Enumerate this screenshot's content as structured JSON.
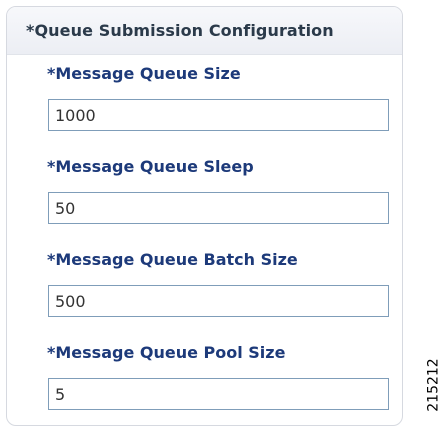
{
  "panel": {
    "title": "*Queue Submission Configuration"
  },
  "fields": [
    {
      "label": "*Message Queue Size",
      "value": "1000"
    },
    {
      "label": "*Message Queue Sleep",
      "value": "50"
    },
    {
      "label": "*Message Queue Batch Size",
      "value": "500"
    },
    {
      "label": "*Message Queue Pool Size",
      "value": "5"
    }
  ],
  "figure_id": "215212"
}
